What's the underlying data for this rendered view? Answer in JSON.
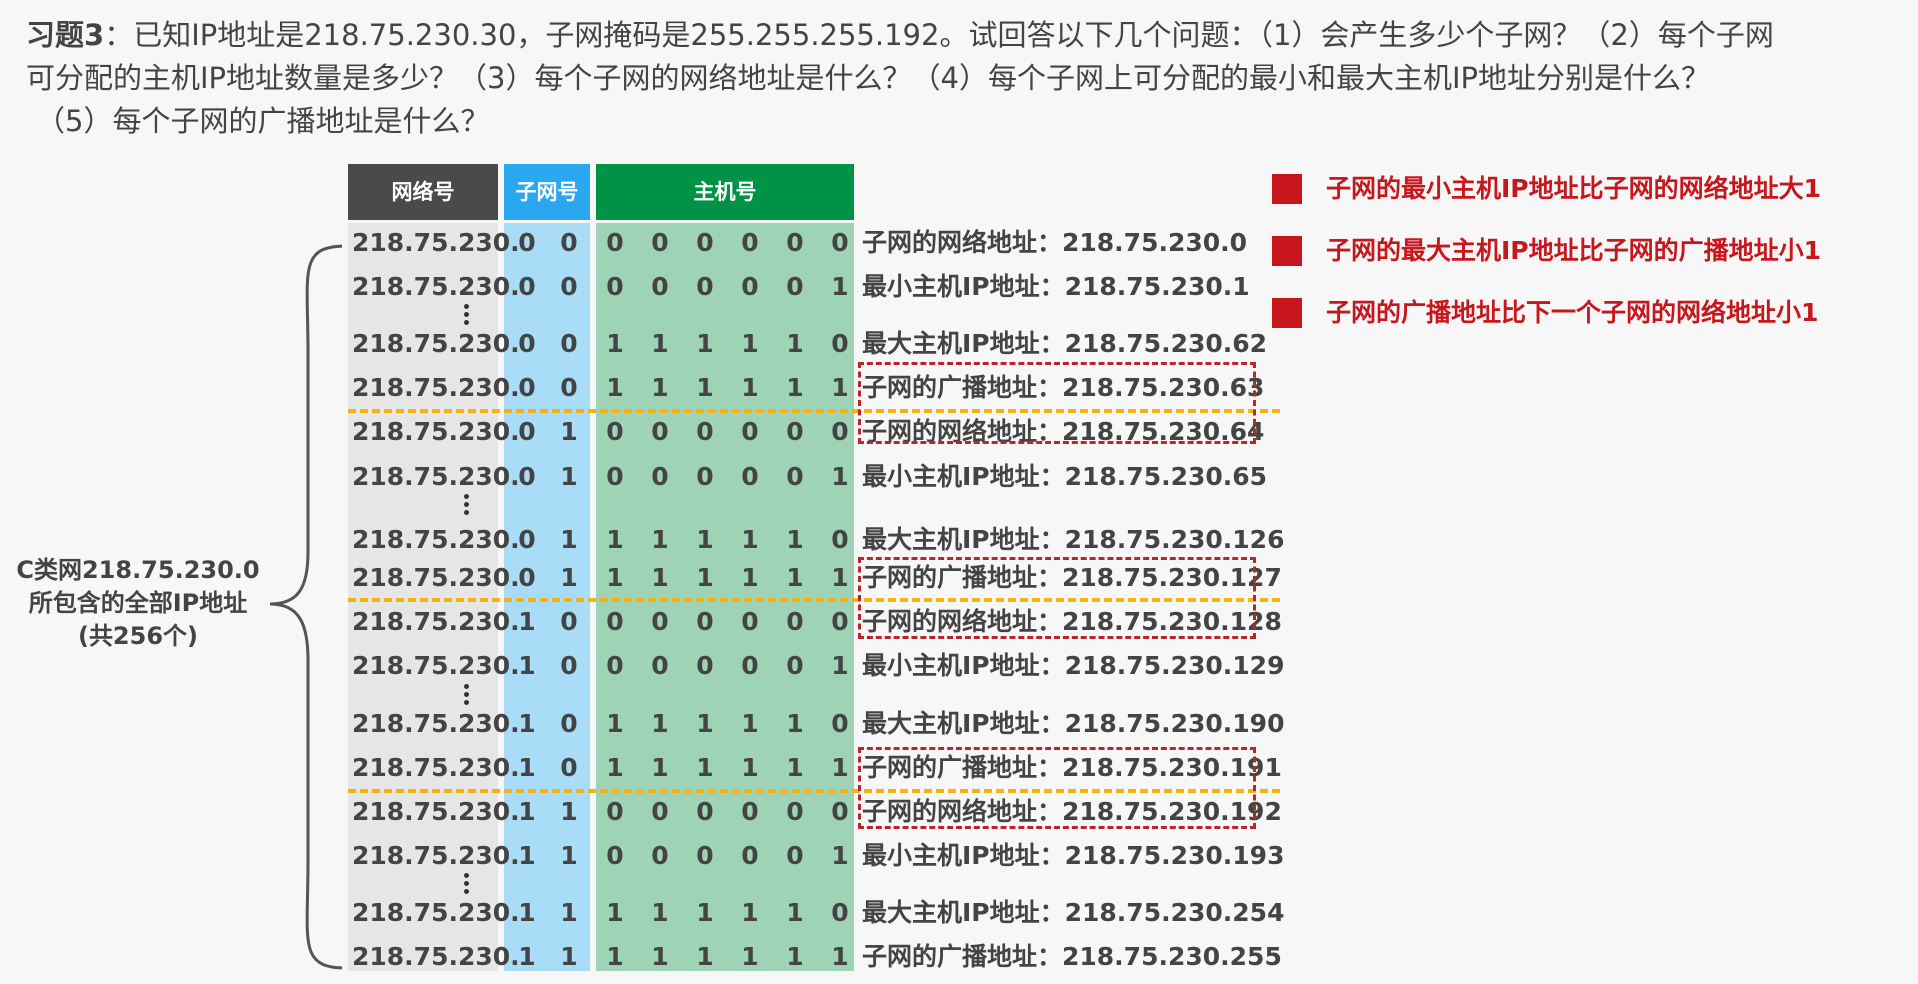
{
  "question": {
    "tag": "习题3",
    "line1": "：已知IP地址是218.75.230.30，子网掩码是255.255.255.192。试回答以下几个问题：（1）会产生多少个子网？（2）每个子网",
    "line2": "可分配的主机IP地址数量是多少？（3）每个子网的网络地址是什么？（4）每个子网上可分配的最小和最大主机IP地址分别是什么？",
    "line3": "（5）每个子网的广播地址是什么？"
  },
  "headers": {
    "network": "网络号",
    "subnet": "子网号",
    "host": "主机号"
  },
  "colors": {
    "network_header": "#4a4a4a",
    "subnet_header": "#29a7ef",
    "host_header": "#009245",
    "network_band": "#e6e6e6",
    "subnet_band": "#a9dcf6",
    "host_band": "#9fd3b6",
    "separator": "#f4b313",
    "highlight_box": "#b8262a",
    "note_red": "#c8161d"
  },
  "side_label": {
    "line1": "C类网218.75.230.0",
    "line2": "所包含的全部IP地址",
    "line3": "(共256个)"
  },
  "notes": [
    "子网的最小主机IP地址比子网的网络地址大1",
    "子网的最大主机IP地址比子网的广播地址小1",
    "子网的广播地址比下一个子网的网络地址小1"
  ],
  "rows": [
    {
      "prefix": "218.75.230.",
      "subnet": [
        "0",
        "0"
      ],
      "host": [
        "0",
        "0",
        "0",
        "0",
        "0",
        "0"
      ],
      "label": "子网的网络地址：218.75.230.0"
    },
    {
      "prefix": "218.75.230.",
      "subnet": [
        "0",
        "0"
      ],
      "host": [
        "0",
        "0",
        "0",
        "0",
        "0",
        "1"
      ],
      "label": "最小主机IP地址：218.75.230.1"
    },
    {
      "prefix": "218.75.230.",
      "subnet": [
        "0",
        "0"
      ],
      "host": [
        "1",
        "1",
        "1",
        "1",
        "1",
        "0"
      ],
      "label": "最大主机IP地址：218.75.230.62"
    },
    {
      "prefix": "218.75.230.",
      "subnet": [
        "0",
        "0"
      ],
      "host": [
        "1",
        "1",
        "1",
        "1",
        "1",
        "1"
      ],
      "label": "子网的广播地址：218.75.230.63"
    },
    {
      "prefix": "218.75.230.",
      "subnet": [
        "0",
        "1"
      ],
      "host": [
        "0",
        "0",
        "0",
        "0",
        "0",
        "0"
      ],
      "label": "子网的网络地址：218.75.230.64"
    },
    {
      "prefix": "218.75.230.",
      "subnet": [
        "0",
        "1"
      ],
      "host": [
        "0",
        "0",
        "0",
        "0",
        "0",
        "1"
      ],
      "label": "最小主机IP地址：218.75.230.65"
    },
    {
      "prefix": "218.75.230.",
      "subnet": [
        "0",
        "1"
      ],
      "host": [
        "1",
        "1",
        "1",
        "1",
        "1",
        "0"
      ],
      "label": "最大主机IP地址：218.75.230.126"
    },
    {
      "prefix": "218.75.230.",
      "subnet": [
        "0",
        "1"
      ],
      "host": [
        "1",
        "1",
        "1",
        "1",
        "1",
        "1"
      ],
      "label": "子网的广播地址：218.75.230.127"
    },
    {
      "prefix": "218.75.230.",
      "subnet": [
        "1",
        "0"
      ],
      "host": [
        "0",
        "0",
        "0",
        "0",
        "0",
        "0"
      ],
      "label": "子网的网络地址：218.75.230.128"
    },
    {
      "prefix": "218.75.230.",
      "subnet": [
        "1",
        "0"
      ],
      "host": [
        "0",
        "0",
        "0",
        "0",
        "0",
        "1"
      ],
      "label": "最小主机IP地址：218.75.230.129"
    },
    {
      "prefix": "218.75.230.",
      "subnet": [
        "1",
        "0"
      ],
      "host": [
        "1",
        "1",
        "1",
        "1",
        "1",
        "0"
      ],
      "label": "最大主机IP地址：218.75.230.190"
    },
    {
      "prefix": "218.75.230.",
      "subnet": [
        "1",
        "0"
      ],
      "host": [
        "1",
        "1",
        "1",
        "1",
        "1",
        "1"
      ],
      "label": "子网的广播地址：218.75.230.191"
    },
    {
      "prefix": "218.75.230.",
      "subnet": [
        "1",
        "1"
      ],
      "host": [
        "0",
        "0",
        "0",
        "0",
        "0",
        "0"
      ],
      "label": "子网的网络地址：218.75.230.192"
    },
    {
      "prefix": "218.75.230.",
      "subnet": [
        "1",
        "1"
      ],
      "host": [
        "0",
        "0",
        "0",
        "0",
        "0",
        "1"
      ],
      "label": "最小主机IP地址：218.75.230.193"
    },
    {
      "prefix": "218.75.230.",
      "subnet": [
        "1",
        "1"
      ],
      "host": [
        "1",
        "1",
        "1",
        "1",
        "1",
        "0"
      ],
      "label": "最大主机IP地址：218.75.230.254"
    },
    {
      "prefix": "218.75.230.",
      "subnet": [
        "1",
        "1"
      ],
      "host": [
        "1",
        "1",
        "1",
        "1",
        "1",
        "1"
      ],
      "label": "子网的广播地址：218.75.230.255"
    }
  ]
}
